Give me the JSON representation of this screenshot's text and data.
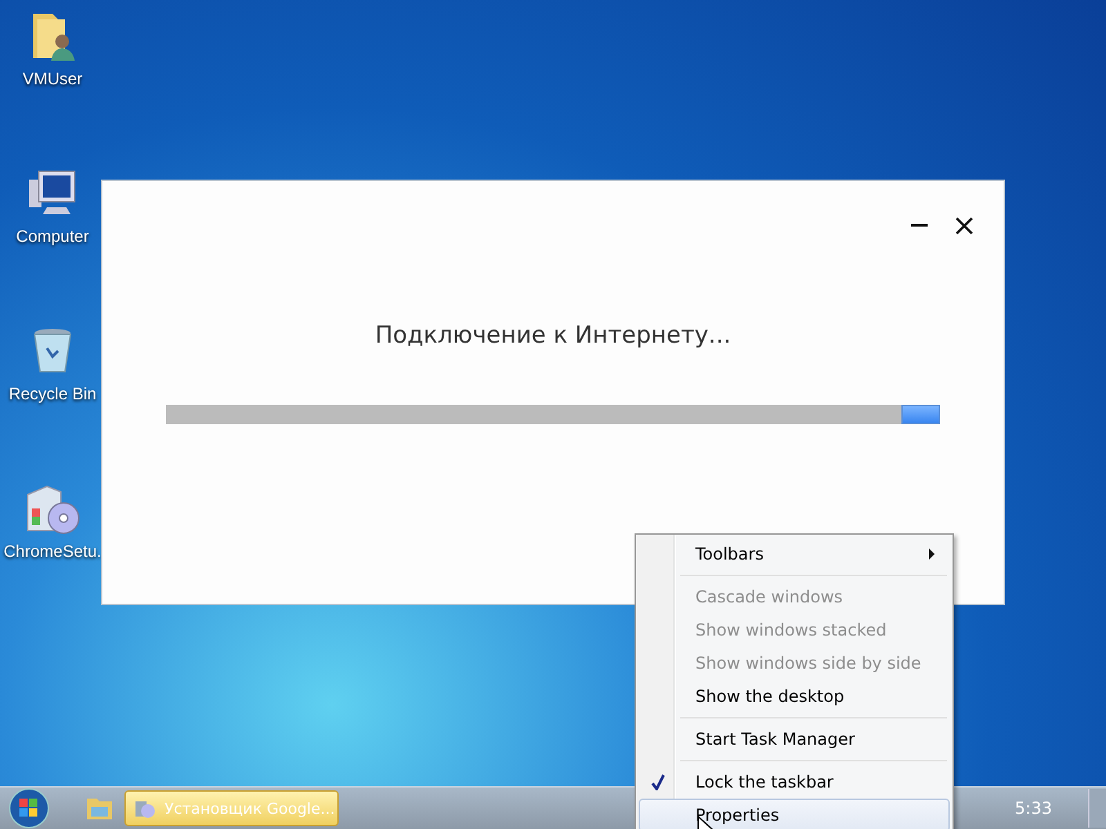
{
  "desktop_icons": [
    {
      "kind": "user-folder",
      "label": "VMUser"
    },
    {
      "kind": "computer",
      "label": "Computer"
    },
    {
      "kind": "recycle-bin",
      "label": "Recycle Bin"
    },
    {
      "kind": "installer",
      "label": "ChromeSetu."
    }
  ],
  "installer_window": {
    "message": "Подключение к Интернету...",
    "progress": {
      "level": 0.05
    }
  },
  "context_menu": {
    "groups": [
      [
        {
          "label": "Toolbars",
          "submenu": true,
          "disabled": false,
          "checked": false,
          "selected": false
        }
      ],
      [
        {
          "label": "Cascade windows",
          "submenu": false,
          "disabled": true,
          "checked": false,
          "selected": false
        },
        {
          "label": "Show windows stacked",
          "submenu": false,
          "disabled": true,
          "checked": false,
          "selected": false
        },
        {
          "label": "Show windows side by side",
          "submenu": false,
          "disabled": true,
          "checked": false,
          "selected": false
        },
        {
          "label": "Show the desktop",
          "submenu": false,
          "disabled": false,
          "checked": false,
          "selected": false
        }
      ],
      [
        {
          "label": "Start Task Manager",
          "submenu": false,
          "disabled": false,
          "checked": false,
          "selected": false
        }
      ],
      [
        {
          "label": "Lock the taskbar",
          "submenu": false,
          "disabled": false,
          "checked": true,
          "selected": false
        },
        {
          "label": "Properties",
          "submenu": false,
          "disabled": false,
          "checked": false,
          "selected": true
        }
      ]
    ]
  },
  "taskbar": {
    "buttons": [
      {
        "label": "Установщик Google...",
        "selected": true
      }
    ],
    "clock": "5:33"
  }
}
